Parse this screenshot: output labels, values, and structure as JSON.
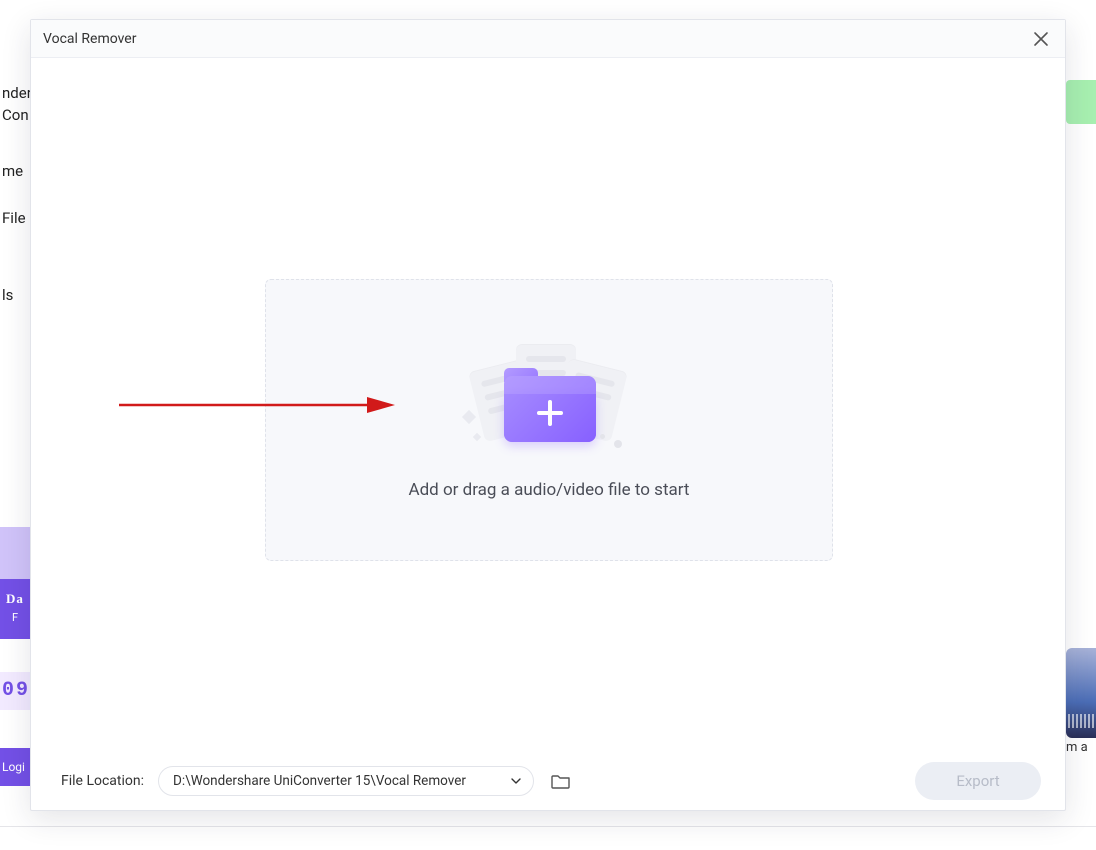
{
  "modal": {
    "title": "Vocal Remover",
    "dropzone_caption": "Add or drag a audio/video file to start"
  },
  "footer": {
    "file_location_label": "File Location:",
    "path": "D:\\Wondershare UniConverter 15\\Vocal Remover",
    "export_label": "Export"
  },
  "background": {
    "frag1": "nder",
    "frag2": "Con",
    "frag3": "me",
    "frag4": "File",
    "frag5": "ls",
    "da": "Da",
    "fr": "F",
    "time": "09",
    "login": "Logi",
    "right_text": "m a"
  },
  "colors": {
    "accent": "#8760ff",
    "annotation": "#d11a1a"
  }
}
